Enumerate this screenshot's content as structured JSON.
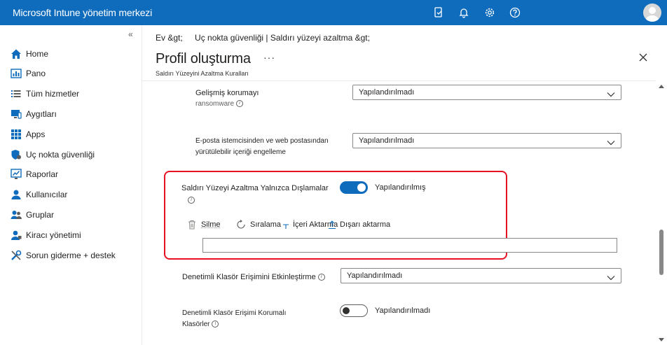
{
  "app": {
    "title": "Microsoft Intune yönetim merkezi"
  },
  "topbar_icons": [
    "device-icon",
    "bell-icon",
    "gear-icon",
    "help-icon"
  ],
  "sidebar": {
    "collapse_label": "«",
    "items": [
      {
        "label": "Home",
        "icon": "home-icon"
      },
      {
        "label": "Pano",
        "icon": "dashboard-icon"
      },
      {
        "label": "Tüm hizmetler",
        "icon": "list-icon"
      },
      {
        "label": "Aygıtları",
        "icon": "devices-icon"
      },
      {
        "label": "Apps",
        "icon": "apps-icon"
      },
      {
        "label": "Uç nokta güvenliği",
        "icon": "shield-icon"
      },
      {
        "label": "Raporlar",
        "icon": "reports-icon"
      },
      {
        "label": "Kullanıcılar",
        "icon": "user-icon"
      },
      {
        "label": "Gruplar",
        "icon": "groups-icon"
      },
      {
        "label": "Kiracı yönetimi",
        "icon": "tenant-icon"
      },
      {
        "label": "Sorun giderme + destek",
        "icon": "tools-icon"
      }
    ]
  },
  "breadcrumb": {
    "home": "Ev &gt;",
    "path": "Uç nokta güvenliği | Saldırı yüzeyi azaltma &gt;"
  },
  "header": {
    "title": "Profil oluşturma",
    "more": "···",
    "subtitle": "Saldırı Yüzeyini Azaltma Kuralları"
  },
  "settings": {
    "ransomware": {
      "label_line1": "Gelişmiş korumayı",
      "label_line2": "ransomware",
      "value": "Yapılandırılmadı"
    },
    "email": {
      "label_line1": "E-posta istemcisinden ve web postasından",
      "label_line2": "yürütülebilir içeriği engelleme",
      "value": "Yapılandırılmadı"
    },
    "exclusions": {
      "label": "Saldırı Yüzeyi Azaltma Yalnızca Dışlamalar",
      "toggle_label": "Yapılandırılmış",
      "toggle_on": true,
      "toolbar": {
        "delete": "Silme",
        "sort": "Sıralama",
        "import": "İçeri Aktarma",
        "export": "Dışarı aktarma"
      },
      "input_value": ""
    },
    "cfa_enable": {
      "label": "Denetimli Klasör Erişimini Etkinleştirme",
      "value": "Yapılandırılmadı"
    },
    "cfa_protected": {
      "label_line1": "Denetimli Klasör Erişimi Korumalı",
      "label_line2": "Klasörler",
      "toggle_label": "Yapılandırılmadı",
      "toggle_on": false
    }
  },
  "colors": {
    "brand": "#0f6cbd",
    "highlight": "#e81123"
  }
}
